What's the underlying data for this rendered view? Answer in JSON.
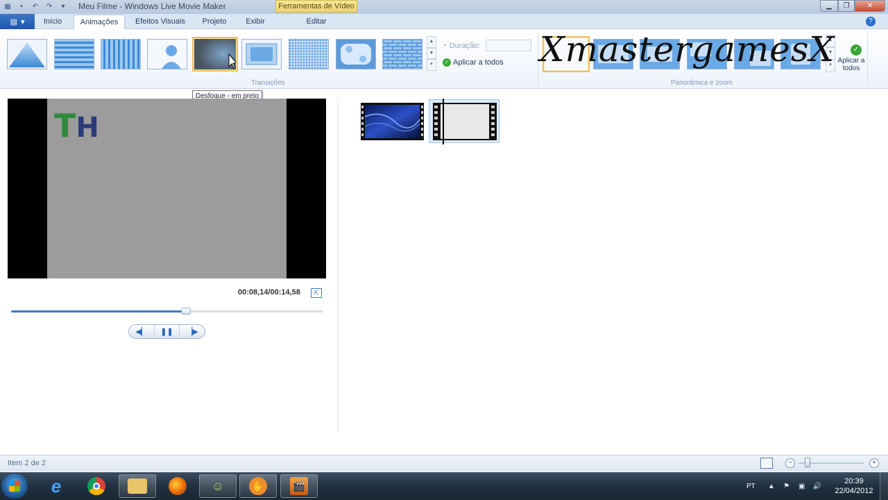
{
  "app": {
    "title": "Meu Filme - Windows Live Movie Maker",
    "contextual_tab": "Ferramentas de Vídeo"
  },
  "tabs": [
    {
      "label": "Início"
    },
    {
      "label": "Animações",
      "active": true
    },
    {
      "label": "Efeitos Visuais"
    },
    {
      "label": "Projeto"
    },
    {
      "label": "Exibir"
    },
    {
      "label": "Editar"
    }
  ],
  "ribbon": {
    "transitions_group_label": "Transições",
    "duration_label": "Duração:",
    "duration_value": "",
    "apply_all_label": "Aplicar a todos",
    "pan_zoom_group_label": "Panorâmica e zoom",
    "pan_zoom_apply_all_label": "Aplicar a todos",
    "watermark_text": "XmastergamesX",
    "selected_transition_index": 4
  },
  "tooltip": {
    "text": "Desfoque - em preto"
  },
  "preview": {
    "logo_t": "T",
    "logo_h": "H",
    "timecode": "00:08,14/00:14,58",
    "playback_progress": 0.56
  },
  "storyboard": {
    "clip_count": 2,
    "selected_clip": 2
  },
  "status": {
    "item_text": "Item 2 de 2",
    "zoom_level": 0.1
  },
  "taskbar": {
    "apps": [
      "windows-explorer",
      "internet-explorer",
      "chrome",
      "file-explorer",
      "firefox",
      "messenger",
      "app",
      "movie-maker"
    ],
    "language": "PT",
    "time": "20:39",
    "date": "22/04/2012"
  },
  "colors": {
    "accent": "#3a7bcf",
    "contextual_tab": "#eed46d",
    "selection": "#e7c15c"
  }
}
